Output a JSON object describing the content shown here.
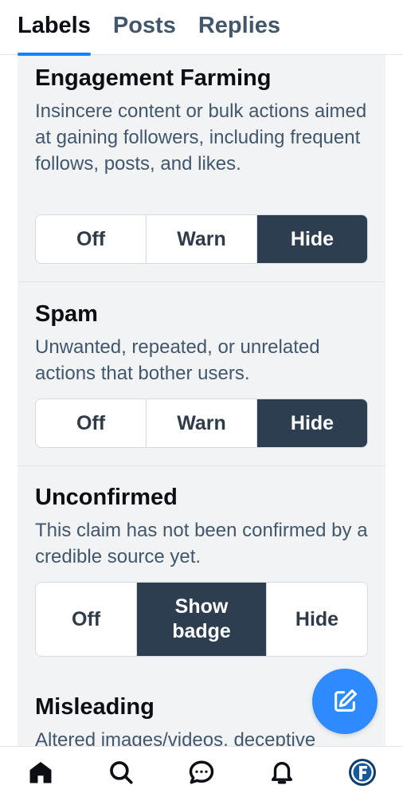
{
  "tabs": [
    "Labels",
    "Posts",
    "Replies"
  ],
  "active_tab": "Labels",
  "labels": [
    {
      "title": "Engagement Farming",
      "description": "Insincere content or bulk actions aimed at gaining followers, including frequent follows, posts, and likes.",
      "options": [
        "Off",
        "Warn",
        "Hide"
      ],
      "selected": "Hide"
    },
    {
      "title": "Spam",
      "description": "Unwanted, repeated, or unrelated actions that bother users.",
      "options": [
        "Off",
        "Warn",
        "Hide"
      ],
      "selected": "Hide"
    },
    {
      "title": "Unconfirmed",
      "description": "This claim has not been confirmed by a credible source yet.",
      "options": [
        "Off",
        "Show badge",
        "Hide"
      ],
      "selected": "Show badge"
    },
    {
      "title": "Misleading",
      "description": "Altered images/videos, deceptive"
    }
  ],
  "fab_icon": "compose-icon",
  "bottom_nav": [
    "home-icon",
    "search-icon",
    "chat-icon",
    "bell-icon",
    "profile-avatar"
  ],
  "colors": {
    "accent": "#1083fe",
    "selected": "#2d3e50",
    "fab": "#2f8aff"
  }
}
